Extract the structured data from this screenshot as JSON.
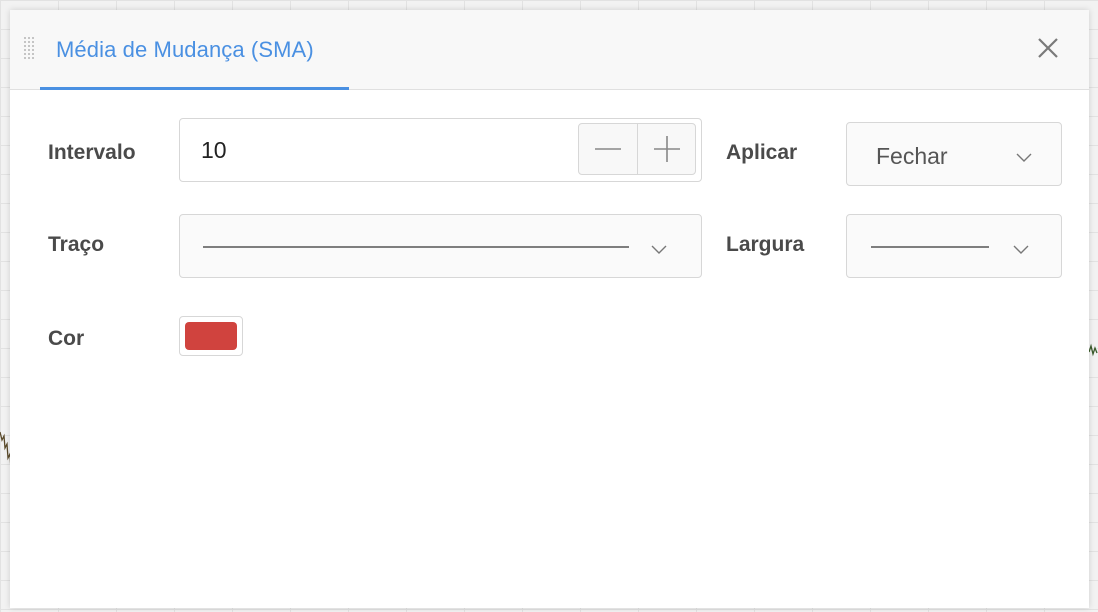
{
  "dialog": {
    "title": "Média de Mudança (SMA)",
    "accent_color": "#4a90e2"
  },
  "fields": {
    "interval": {
      "label": "Intervalo",
      "value": "10"
    },
    "apply": {
      "label": "Aplicar",
      "value": "Fechar"
    },
    "stroke": {
      "label": "Traço"
    },
    "width": {
      "label": "Largura"
    },
    "color": {
      "label": "Cor",
      "value": "#d0433e"
    }
  },
  "icons": [
    "drag-handle-icon",
    "close-icon",
    "minus-icon",
    "plus-icon",
    "chevron-down-icon"
  ]
}
